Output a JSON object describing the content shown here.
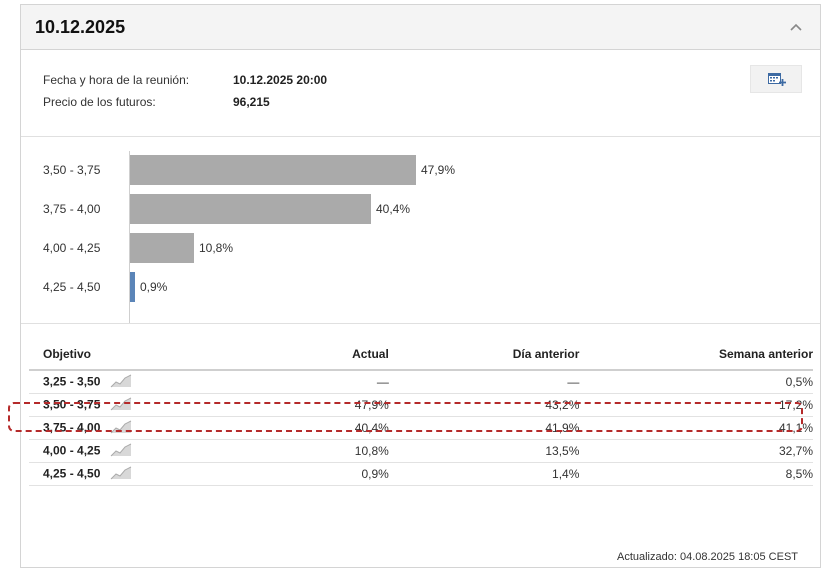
{
  "header": {
    "title": "10.12.2025"
  },
  "meeting": {
    "date_label": "Fecha y hora de la reunión:",
    "date_value": "10.12.2025 20:00",
    "futures_label": "Precio de los futuros:",
    "futures_value": "96,215"
  },
  "probability_bars": [
    {
      "range": "3,50 - 3,75",
      "value_label": "47,9%",
      "value": 47.9
    },
    {
      "range": "3,75 - 4,00",
      "value_label": "40,4%",
      "value": 40.4
    },
    {
      "range": "4,00 - 4,25",
      "value_label": "10,8%",
      "value": 10.8
    },
    {
      "range": "4,25 - 4,50",
      "value_label": "0,9%",
      "value": 0.9
    }
  ],
  "table": {
    "columns": [
      "Objetivo",
      "Actual",
      "Día anterior",
      "Semana anterior"
    ],
    "rows": [
      {
        "target": "3,25 - 3,50",
        "actual": "—",
        "prev_day": "—",
        "prev_week": "0,5%"
      },
      {
        "target": "3,50 - 3,75",
        "actual": "47,9%",
        "prev_day": "43,2%",
        "prev_week": "17,2%"
      },
      {
        "target": "3,75 - 4,00",
        "actual": "40,4%",
        "prev_day": "41,9%",
        "prev_week": "41,1%"
      },
      {
        "target": "4,00 - 4,25",
        "actual": "10,8%",
        "prev_day": "13,5%",
        "prev_week": "32,7%"
      },
      {
        "target": "4,25 - 4,50",
        "actual": "0,9%",
        "prev_day": "1,4%",
        "prev_week": "8,5%"
      }
    ]
  },
  "footer": {
    "updated": "Actualizado: 04.08.2025 18:05 CEST"
  },
  "colors": {
    "bar": "#aaaaaa",
    "bar_small": "#5b85b8",
    "highlight": "#b52a2a"
  },
  "icons": {
    "collapse": "chevron-up-icon",
    "calendar": "add-to-calendar-icon",
    "sparkline": "sparkline-icon"
  }
}
